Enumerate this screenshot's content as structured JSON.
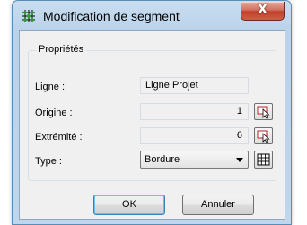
{
  "window": {
    "title": "Modification de segment",
    "close_label": "X"
  },
  "group": {
    "title": "Propriétés"
  },
  "fields": {
    "ligne": {
      "label": "Ligne :",
      "value": "Ligne Projet"
    },
    "origine": {
      "label": "Origine :",
      "value": "1"
    },
    "extremite": {
      "label": "Extrémité :",
      "value": "6"
    },
    "type": {
      "label": "Type :",
      "selected": "Bordure"
    }
  },
  "buttons": {
    "ok": "OK",
    "cancel": "Annuler"
  },
  "icons": {
    "app": "segment-network-icon",
    "pick": "pick-point-arrow-icon",
    "table": "grid-table-icon"
  },
  "colors": {
    "accent": "#3c7fb1",
    "close": "#c1402c"
  }
}
